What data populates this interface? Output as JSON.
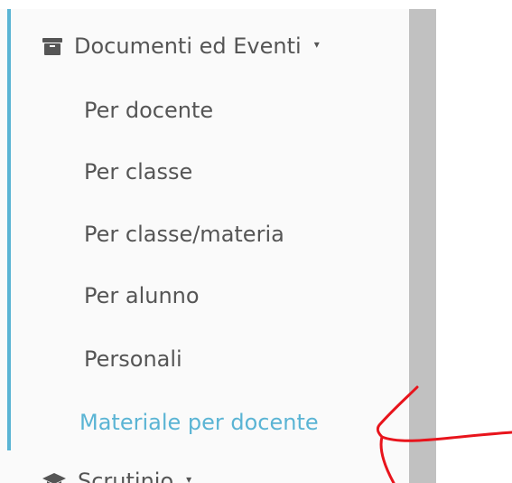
{
  "sidebar": {
    "section": {
      "label": "Documenti ed Eventi",
      "icon": "archive-icon",
      "caret": "▾"
    },
    "items": [
      {
        "label": "Per docente",
        "active": false
      },
      {
        "label": "Per classe",
        "active": false
      },
      {
        "label": "Per classe/materia",
        "active": false
      },
      {
        "label": "Per alunno",
        "active": false
      },
      {
        "label": "Personali",
        "active": false
      },
      {
        "label": "Materiale per docente",
        "active": true
      }
    ],
    "next_section": {
      "label": "Scrutinio",
      "icon": "graduation-cap-icon",
      "caret": "▾"
    }
  },
  "colors": {
    "accent": "#5ab4d4",
    "text": "#555555",
    "sidebar_bg": "#fafafa",
    "annotation": "#e8141c"
  }
}
